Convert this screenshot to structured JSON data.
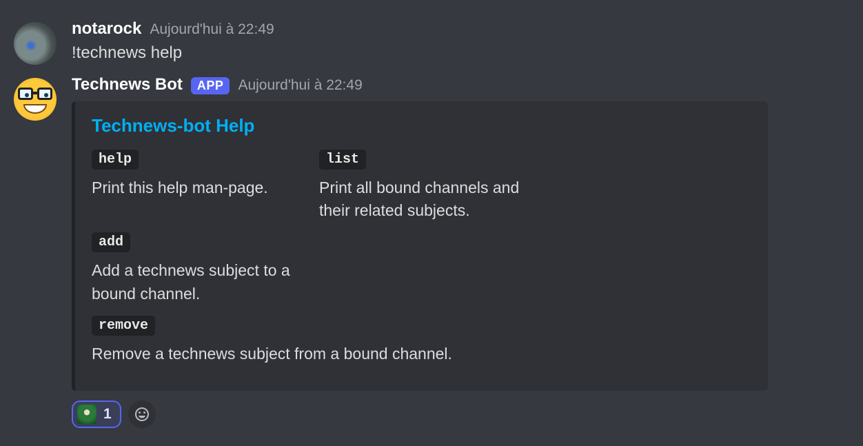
{
  "messages": {
    "user": {
      "username": "notarock",
      "timestamp": "Aujourd'hui à 22:49",
      "content": "!technews help"
    },
    "bot": {
      "username": "Technews Bot",
      "bot_tag": "APP",
      "timestamp": "Aujourd'hui à 22:49",
      "embed": {
        "title": "Technews-bot Help",
        "fields": [
          {
            "name": "help",
            "value": "Print this help man-page."
          },
          {
            "name": "list",
            "value": "Print all bound channels and their related subjects."
          },
          {
            "name": "add",
            "value": "Add a technews subject to a bound channel."
          },
          {
            "name": "remove",
            "value": "Remove a technews subject from a bound channel."
          }
        ]
      },
      "reaction_count": "1"
    }
  }
}
